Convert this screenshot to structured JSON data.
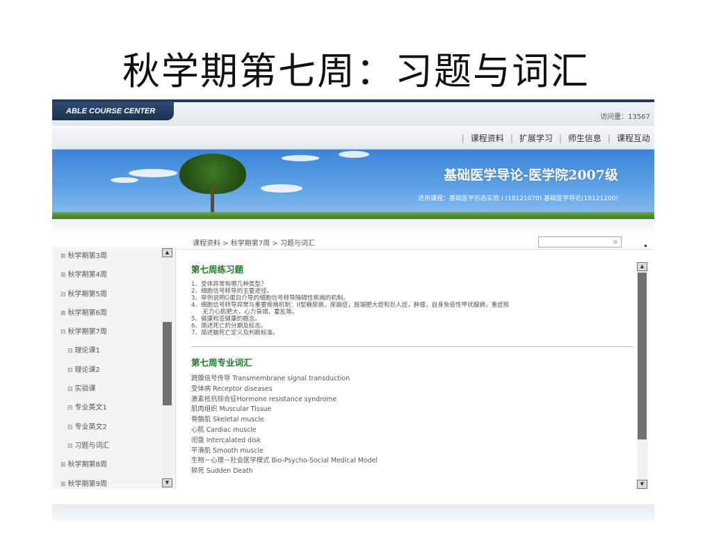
{
  "slide": {
    "title": "秋学期第七周：习题与词汇"
  },
  "header": {
    "brand": "ABLE COURSE CENTER",
    "visits": "访问量：13567"
  },
  "nav": {
    "items": [
      {
        "label": "课程资料"
      },
      {
        "label": "扩展学习"
      },
      {
        "label": "师生信息"
      },
      {
        "label": "课程互动"
      }
    ]
  },
  "banner": {
    "title": "基础医学导论-医学院2007级",
    "subtitle": "适用课程：基础医学形态实验 I (18121070) 基础医学导论(18121200)"
  },
  "breadcrumb": "课程资料 > 秋学期第7周  > 习题与词汇",
  "search": {
    "value": "",
    "placeholder": ""
  },
  "sidebar": {
    "items": [
      {
        "label": "秋学期第3周",
        "toggle": "⊞",
        "child": false
      },
      {
        "label": "秋学期第4周",
        "toggle": "⊞",
        "child": false
      },
      {
        "label": "秋学期第5周",
        "toggle": "⊟",
        "child": false
      },
      {
        "label": "秋学期第6周",
        "toggle": "⊞",
        "child": false
      },
      {
        "label": "秋学期第7周",
        "toggle": "⊟",
        "child": false
      },
      {
        "label": "理论课1",
        "toggle": "⊟",
        "child": true
      },
      {
        "label": "理论课2",
        "toggle": "⊟",
        "child": true
      },
      {
        "label": "实验课",
        "toggle": "⊟",
        "child": true
      },
      {
        "label": "专业英文1",
        "toggle": "⊟",
        "child": true
      },
      {
        "label": "专业英文2",
        "toggle": "⊟",
        "child": true
      },
      {
        "label": "习题与词汇",
        "toggle": "⊟",
        "child": true
      },
      {
        "label": "秋学期第8周",
        "toggle": "⊞",
        "child": false
      },
      {
        "label": "秋学期第9周",
        "toggle": "⊞",
        "child": false
      }
    ]
  },
  "content": {
    "exercises_title": "第七周练习题",
    "exercises": [
      {
        "text": "1、受体异常有哪几种类型？",
        "indent": false
      },
      {
        "text": "2、细胞信号转导的主要途径。",
        "indent": false
      },
      {
        "text": "3、举例说明G蛋白介导的细胞信号转导障碍性疾病的机制。",
        "indent": false
      },
      {
        "text": "4、细胞信号转导异常与重要疾病机制：II型糖尿病，尿崩症，肢端肥大症和巨人症，肿瘤，自身免疫性甲状腺病，重症肌",
        "indent": false
      },
      {
        "text": "无力心肌肥大，心力衰竭，霍乱等。",
        "indent": true
      },
      {
        "text": "5、健康和亚健康的概念。",
        "indent": false
      },
      {
        "text": "6、简述死亡的分期及标志。",
        "indent": false
      },
      {
        "text": "7、简述脑死亡定义及判断标准。",
        "indent": false
      }
    ],
    "vocab_title": "第七周专业词汇",
    "vocab": [
      "跨膜信号传导  Transmembrane signal transduction",
      "受体病  Receptor diseases",
      "激素抵抗综合征Hormone resistance syndrome",
      "肌肉组织  Muscular Tissue",
      "骨骼肌  Skeletal muscle",
      "心肌  Cardiac muscle",
      "闰盘  Intercalated disk",
      "平滑肌  Smooth muscle",
      "生物－心理－社会医学模式   Bio-Psycho-Social Medical Model",
      "猝死  Sudden Death"
    ]
  },
  "icons": {
    "scroll_up": "▲",
    "scroll_down": "▼",
    "search": "⌕"
  }
}
